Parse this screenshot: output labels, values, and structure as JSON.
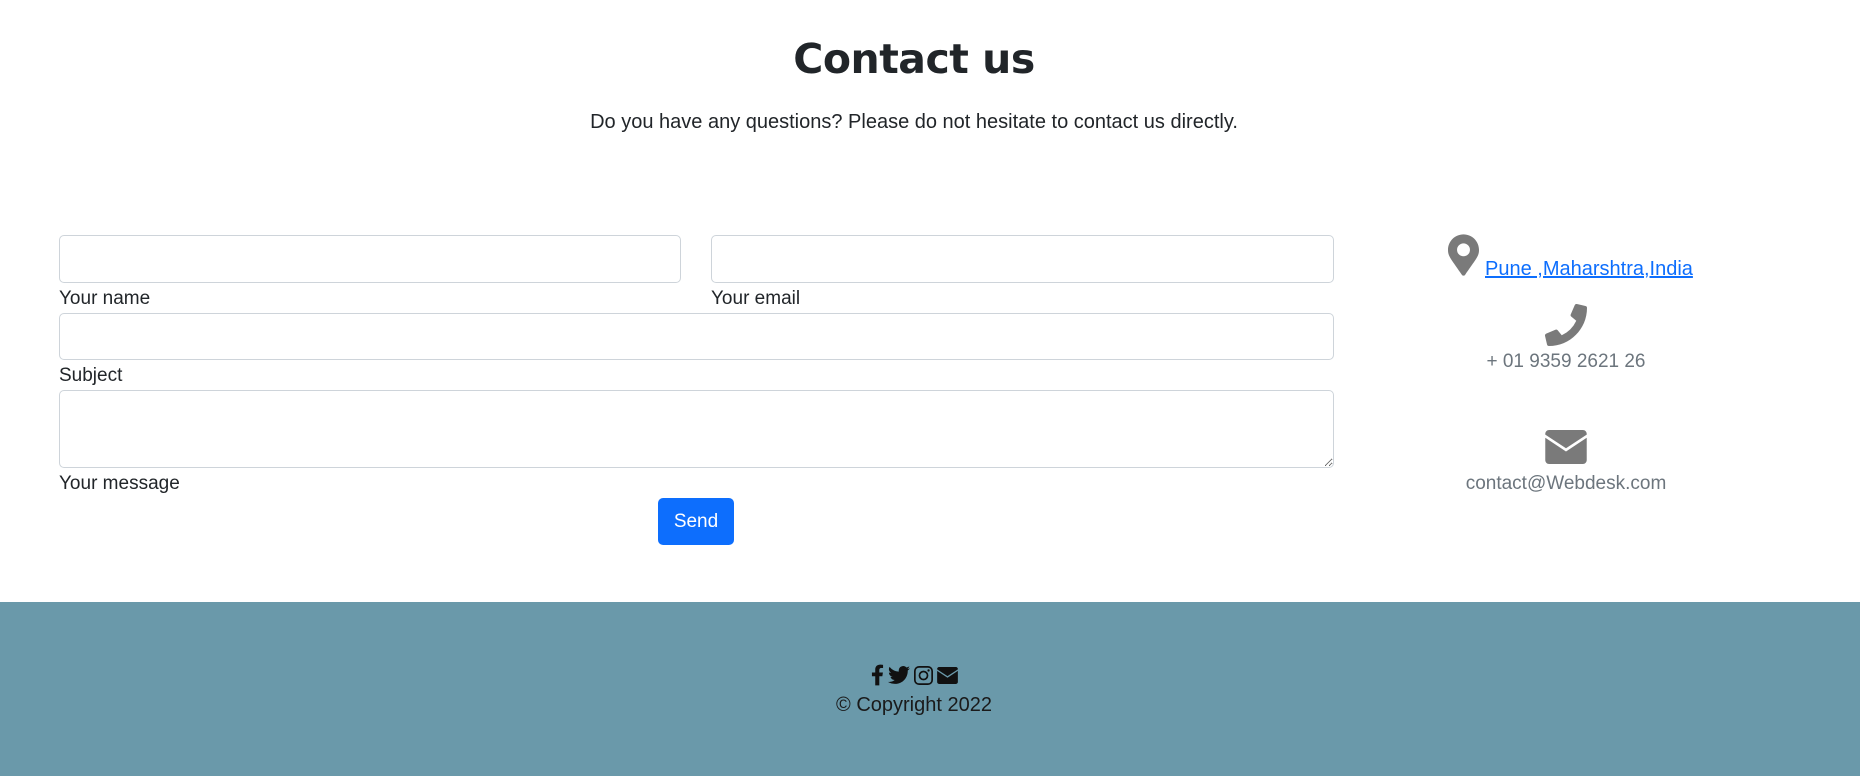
{
  "header": {
    "title": "Contact us",
    "subtitle": "Do you have any questions? Please do not hesitate to contact us directly."
  },
  "form": {
    "name_label": "Your name",
    "name_value": "",
    "email_label": "Your email",
    "email_value": "",
    "subject_label": "Subject",
    "subject_value": "",
    "message_label": "Your message",
    "message_value": "",
    "send_label": "Send"
  },
  "contact": {
    "address": "Pune ,Maharshtra,India",
    "phone": "+ 01 9359 2621 26",
    "email": "contact@Webdesk.com",
    "icons": [
      "map-marker-icon",
      "phone-icon",
      "envelope-icon"
    ]
  },
  "footer": {
    "social_icons": [
      "facebook-icon",
      "twitter-icon",
      "instagram-icon",
      "envelope-icon"
    ],
    "copyright": "© Copyright 2022"
  },
  "colors": {
    "accent": "#0d6efd",
    "footer_bg": "#6a99aa",
    "muted_icon": "#7a7a7a"
  }
}
